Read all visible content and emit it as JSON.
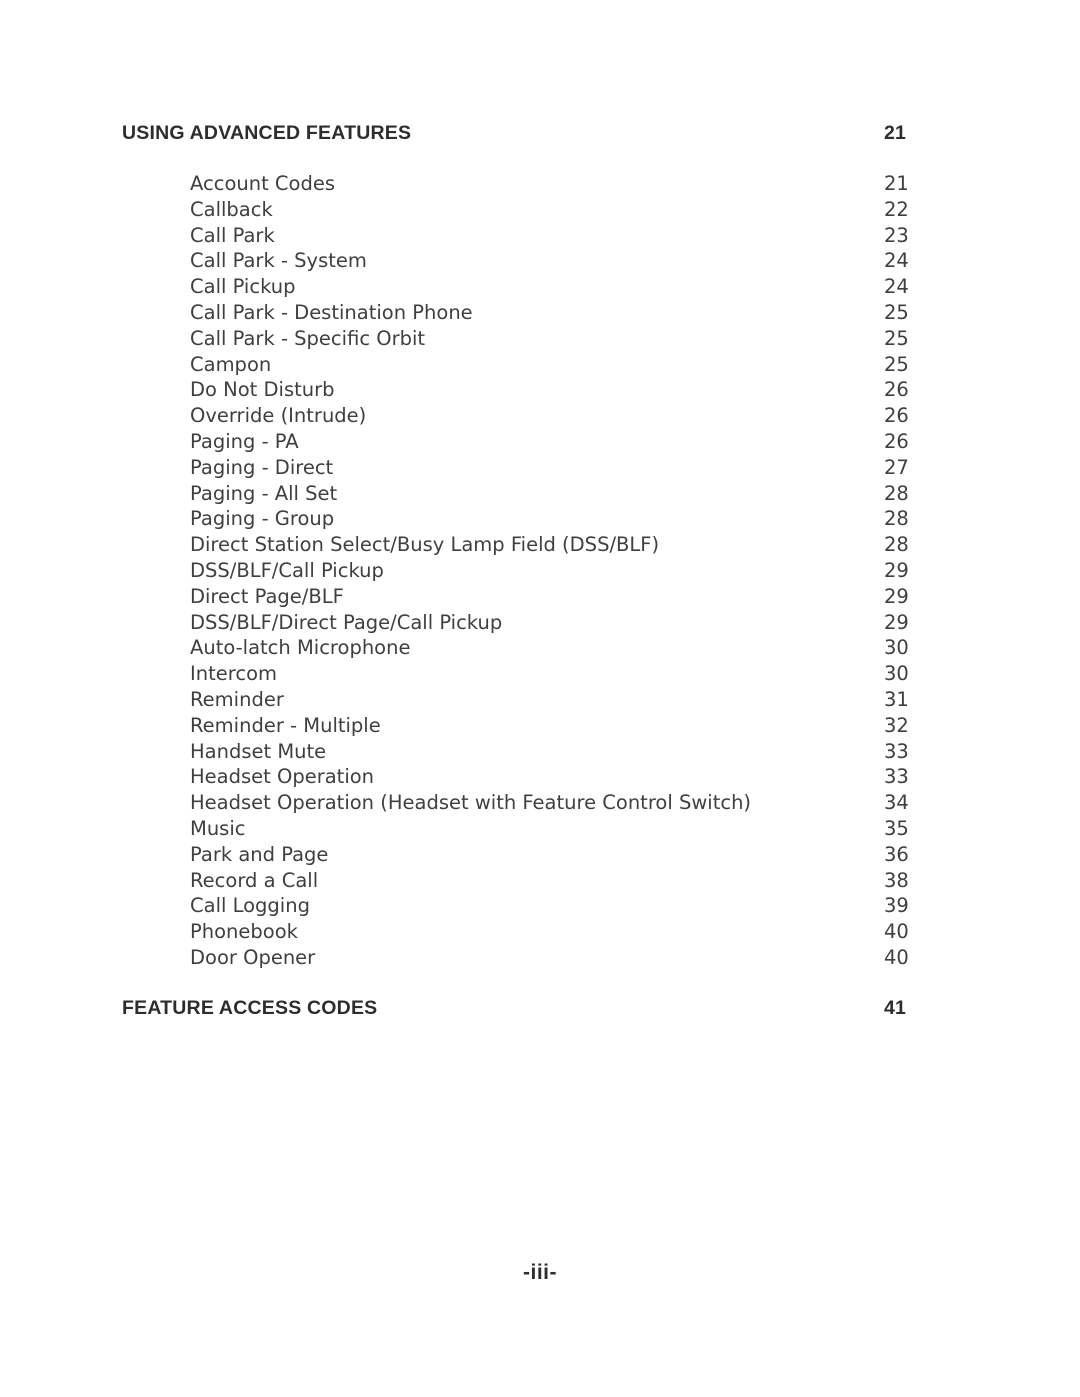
{
  "document": {
    "type": "table-of-contents",
    "folio": "-iii-"
  },
  "sections": [
    {
      "heading": "USING ADVANCED FEATURES",
      "page": "21",
      "entries": [
        {
          "title": "Account Codes",
          "page": "21"
        },
        {
          "title": "Callback",
          "page": "22"
        },
        {
          "title": "Call Park",
          "page": "23"
        },
        {
          "title": "Call Park - System",
          "page": "24"
        },
        {
          "title": "Call Pickup",
          "page": "24"
        },
        {
          "title": "Call Park - Destination Phone",
          "page": "25"
        },
        {
          "title": "Call Park - Specific Orbit",
          "page": "25"
        },
        {
          "title": "Campon",
          "page": "25"
        },
        {
          "title": "Do Not Disturb",
          "page": "26"
        },
        {
          "title": "Override (Intrude)",
          "page": "26"
        },
        {
          "title": "Paging - PA",
          "page": "26"
        },
        {
          "title": "Paging - Direct",
          "page": "27"
        },
        {
          "title": "Paging - All Set",
          "page": "28"
        },
        {
          "title": "Paging - Group",
          "page": "28"
        },
        {
          "title": "Direct Station Select/Busy Lamp Field (DSS/BLF)",
          "page": "28"
        },
        {
          "title": "DSS/BLF/Call Pickup",
          "page": "29"
        },
        {
          "title": "Direct Page/BLF",
          "page": "29"
        },
        {
          "title": "DSS/BLF/Direct Page/Call Pickup",
          "page": "29"
        },
        {
          "title": "Auto-latch Microphone",
          "page": "30"
        },
        {
          "title": "Intercom",
          "page": "30"
        },
        {
          "title": "Reminder",
          "page": "31"
        },
        {
          "title": "Reminder - Multiple",
          "page": "32"
        },
        {
          "title": "Handset Mute",
          "page": "33"
        },
        {
          "title": "Headset Operation",
          "page": "33"
        },
        {
          "title": "Headset Operation (Headset with Feature Control Switch)",
          "page": "34"
        },
        {
          "title": "Music",
          "page": "35"
        },
        {
          "title": "Park and Page",
          "page": "36"
        },
        {
          "title": "Record a Call",
          "page": "38"
        },
        {
          "title": "Call Logging",
          "page": "39"
        },
        {
          "title": "Phonebook",
          "page": "40"
        },
        {
          "title": "Door Opener",
          "page": "40"
        }
      ]
    },
    {
      "heading": "FEATURE ACCESS CODES",
      "page": "41",
      "entries": []
    }
  ]
}
